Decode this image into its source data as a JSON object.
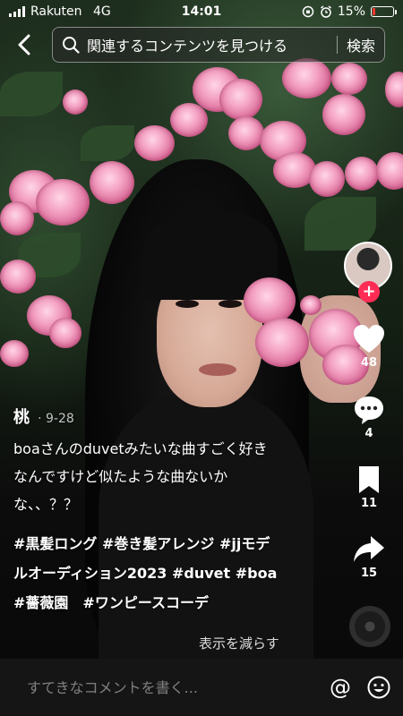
{
  "status_bar": {
    "carrier": "Rakuten",
    "network": "4G",
    "time": "14:01",
    "battery": "15%",
    "battery_level": 0.15
  },
  "search": {
    "query": "関連するコンテンツを見つける",
    "button": "検索"
  },
  "video": {
    "author": "桃",
    "date": "· 9-28",
    "description_lines": [
      "boaさんのduvetみたいな曲すごく好き",
      "なんですけど似たような曲ないか",
      "な、、？？"
    ],
    "hashtag_lines": [
      "#黒髪ロング #巻き髪アレンジ #jjモデ",
      "ルオーディション2023 #duvet #boa",
      "#薔薇園　#ワンピースコーデ"
    ],
    "show_less": "表示を減らす"
  },
  "actions": {
    "likes": "48",
    "comments": "4",
    "saves": "11",
    "shares": "15"
  },
  "comment_bar": {
    "placeholder": "すてきなコメントを書く...",
    "at_symbol": "@"
  },
  "colors": {
    "accent": "#fe2c55",
    "battery_low": "#ff3b30"
  },
  "icons": [
    "back-icon",
    "search-icon",
    "heart-icon",
    "comment-icon",
    "bookmark-icon",
    "share-icon",
    "music-disc-icon",
    "emoji-icon"
  ]
}
